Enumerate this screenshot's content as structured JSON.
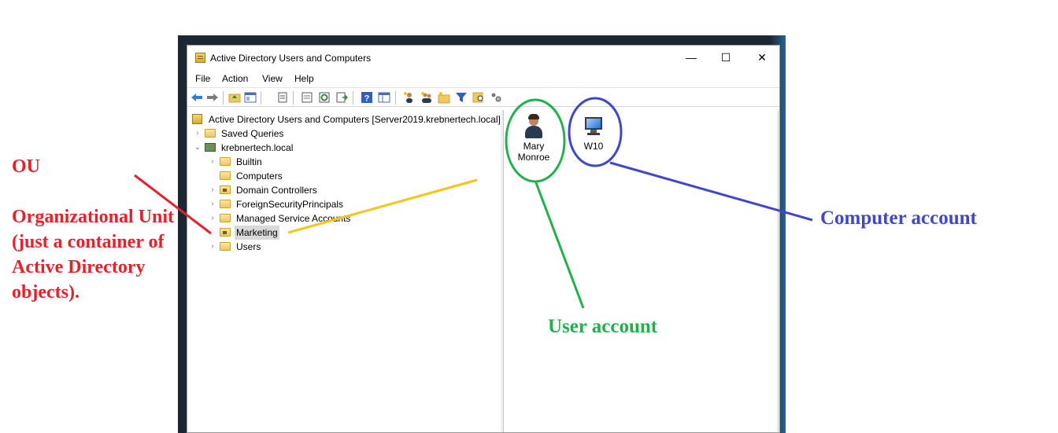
{
  "window": {
    "title": "Active Directory Users and Computers",
    "controls": {
      "minimize": "—",
      "maximize": "☐",
      "close": "✕"
    }
  },
  "menu": [
    "File",
    "Action",
    "View",
    "Help"
  ],
  "toolbar": {
    "icons": [
      "back-arrow-icon",
      "forward-arrow-icon",
      "up-folder-icon",
      "show-tree-icon",
      "copy-icon",
      "properties-icon",
      "refresh-icon",
      "export-list-icon",
      "help-icon",
      "console-view-icon",
      "new-user-icon",
      "new-group-icon",
      "new-ou-icon",
      "filter-icon",
      "find-icon",
      "delegate-icon"
    ]
  },
  "tree": {
    "root": "Active Directory Users and Computers [Server2019.krebnertech.local]",
    "saved_queries": "Saved Queries",
    "domain": "krebnertech.local",
    "children": [
      "Builtin",
      "Computers",
      "Domain Controllers",
      "ForeignSecurityPrincipals",
      "Managed Service Accounts",
      "Marketing",
      "Users"
    ],
    "selected": "Marketing"
  },
  "list": {
    "items": [
      {
        "label_line1": "Mary",
        "label_line2": "Monroe",
        "icon": "user-icon"
      },
      {
        "label_line1": "W10",
        "icon": "computer-icon"
      }
    ]
  },
  "annotations": {
    "ou_title": "OU",
    "ou_desc": "Organizational Unit (just a container of Active Directory objects).",
    "user_account": "User account",
    "computer_account": "Computer account",
    "colors": {
      "ou": "#e8202a",
      "user": "#21b14b",
      "computer": "#3f48cc",
      "marketing_line": "#f5c518"
    }
  }
}
